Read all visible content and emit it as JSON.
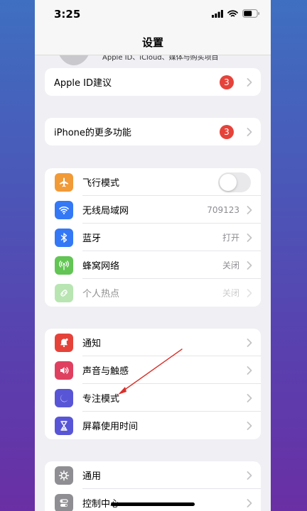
{
  "status": {
    "time": "3:25"
  },
  "nav": {
    "title": "设置"
  },
  "profile": {
    "subtitle": "Apple ID、iCloud、媒体与购买项目"
  },
  "apple_id_suggestion": {
    "label": "Apple ID建议",
    "badge": "3"
  },
  "more_features": {
    "label": "iPhone的更多功能",
    "badge": "3"
  },
  "connectivity": {
    "airplane": {
      "label": "飞行模式",
      "on": false
    },
    "wifi": {
      "label": "无线局域网",
      "value": "709123"
    },
    "bluetooth": {
      "label": "蓝牙",
      "value": "打开"
    },
    "cellular": {
      "label": "蜂窝网络",
      "value": "关闭"
    },
    "hotspot": {
      "label": "个人热点",
      "value": "关闭"
    }
  },
  "alerts": {
    "notifications": {
      "label": "通知"
    },
    "sounds": {
      "label": "声音与触感"
    },
    "focus": {
      "label": "专注模式"
    },
    "screen_time": {
      "label": "屏幕使用时间"
    }
  },
  "system": {
    "general": {
      "label": "通用"
    },
    "control_center": {
      "label": "控制中心"
    }
  },
  "colors": {
    "airplane": "#f19a38",
    "wifi": "#3478f6",
    "bluetooth": "#3478f6",
    "cellular": "#62c554",
    "hotspot": "#62c554",
    "notifications": "#e5433a",
    "sounds": "#e04060",
    "focus": "#5856d6",
    "screen_time": "#5856d6",
    "general": "#8e8e93",
    "control_center": "#8e8e93",
    "badge": "#e5433a",
    "annotation_arrow": "#d9302a"
  }
}
